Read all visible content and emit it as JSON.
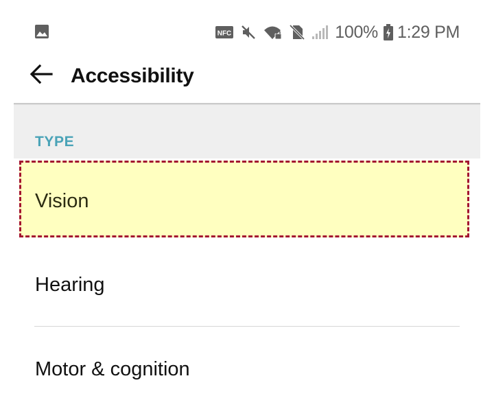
{
  "status_bar": {
    "left_icons": [
      "gallery-icon"
    ],
    "right_icons": [
      "nfc-icon",
      "mute-icon",
      "wifi-locked-icon",
      "no-sim-icon",
      "signal-icon",
      "battery-charging-icon"
    ],
    "nfc_label": "NFC",
    "battery_percent": "100%",
    "time": "1:29 PM"
  },
  "app_bar": {
    "back_icon": "arrow-back-icon",
    "title": "Accessibility"
  },
  "section": {
    "header": "TYPE"
  },
  "items": [
    {
      "label": "Vision",
      "highlighted": true
    },
    {
      "label": "Hearing",
      "highlighted": false
    },
    {
      "label": "Motor & cognition",
      "highlighted": false
    }
  ],
  "colors": {
    "section_header_text": "#4aa3b7",
    "section_header_bg": "#efefef",
    "highlight_fill": "#ffffc0",
    "highlight_border": "#a31330",
    "status_icons": "#5f5f5f"
  }
}
